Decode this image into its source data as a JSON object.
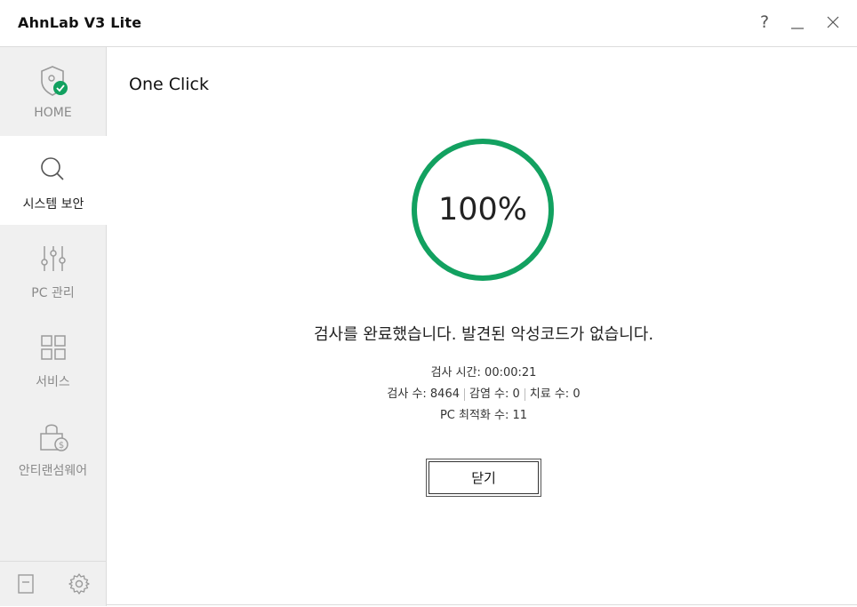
{
  "app": {
    "title": "AhnLab V3 Lite"
  },
  "window": {
    "help": "?"
  },
  "sidebar": {
    "items": [
      {
        "label": "HOME",
        "icon": "shield-check-icon"
      },
      {
        "label": "시스템 보안",
        "icon": "search-icon"
      },
      {
        "label": "PC 관리",
        "icon": "sliders-icon"
      },
      {
        "label": "서비스",
        "icon": "grid-icon"
      },
      {
        "label": "안티랜섬웨어",
        "icon": "lock-dollar-icon"
      }
    ],
    "active_index": 1,
    "bottom": [
      "document-icon",
      "gear-icon"
    ]
  },
  "main": {
    "title": "One Click",
    "progress": {
      "value": 100,
      "label": "100%"
    },
    "message": "검사를 완료했습니다. 발견된 악성코드가 없습니다.",
    "scan_time": "검사 시간: 00:00:21",
    "scan_count": "검사 수: 8464",
    "infected_count": "감염 수: 0",
    "cured_count": "치료 수: 0",
    "optimized_count": "PC 최적화 수: 11",
    "close_label": "닫기"
  },
  "colors": {
    "accent": "#12a160",
    "sidebar_bg": "#f0f0f0",
    "icon_gray": "#9a9a9a"
  }
}
